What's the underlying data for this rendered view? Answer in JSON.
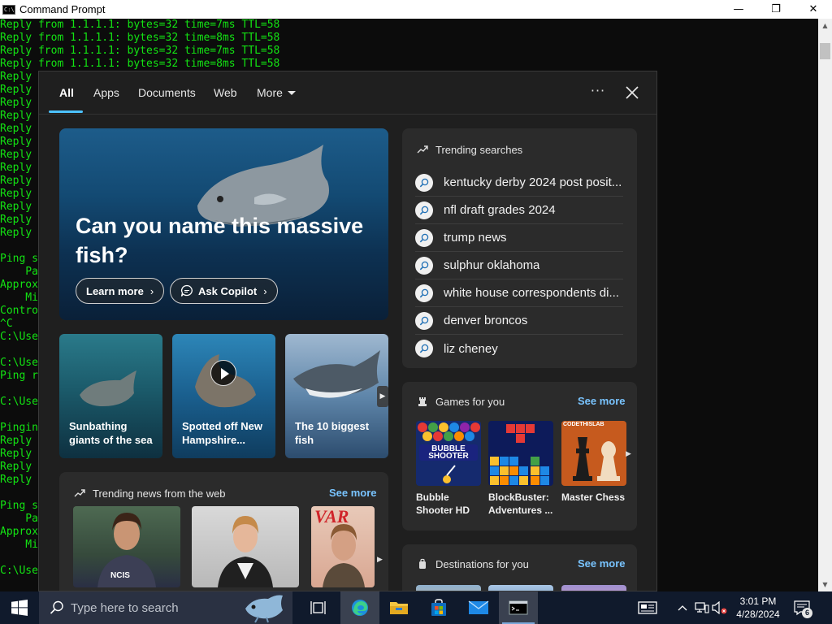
{
  "window": {
    "title": "Command Prompt",
    "minimize_glyph": "—",
    "maximize_glyph": "❐",
    "close_glyph": "✕"
  },
  "console": {
    "ping_reply_lines": [
      "Reply from 1.1.1.1: bytes=32 time=7ms TTL=58",
      "Reply from 1.1.1.1: bytes=32 time=8ms TTL=58",
      "Reply from 1.1.1.1: bytes=32 time=7ms TTL=58",
      "Reply from 1.1.1.1: bytes=32 time=8ms TTL=58"
    ],
    "left_edge_lines": [
      {
        "text": "Reply",
        "kind": "green"
      },
      {
        "text": "Reply",
        "kind": "green"
      },
      {
        "text": "Reply",
        "kind": "green"
      },
      {
        "text": "Reply",
        "kind": "green"
      },
      {
        "text": "Reply",
        "kind": "green"
      },
      {
        "text": "Reply",
        "kind": "green"
      },
      {
        "text": "Reply",
        "kind": "green"
      },
      {
        "text": "Reply",
        "kind": "green"
      },
      {
        "text": "Reply",
        "kind": "green"
      },
      {
        "text": "Reply",
        "kind": "green"
      },
      {
        "text": "Reply",
        "kind": "green"
      },
      {
        "text": "Reply",
        "kind": "green"
      },
      {
        "text": "Reply",
        "kind": "green"
      },
      {
        "text": "",
        "kind": "green"
      },
      {
        "text": "Ping s",
        "kind": "green"
      },
      {
        "text": "    Pa",
        "kind": "green"
      },
      {
        "text": "Approx",
        "kind": "green"
      },
      {
        "text": "    Mi",
        "kind": "green"
      },
      {
        "text": "Contro",
        "kind": "green"
      },
      {
        "text": "^C",
        "kind": "green"
      },
      {
        "text": "C:\\Use",
        "kind": "green"
      },
      {
        "text": "",
        "kind": "green"
      },
      {
        "text": "C:\\Use",
        "kind": "green"
      },
      {
        "text": "Ping r",
        "kind": "green"
      },
      {
        "text": "",
        "kind": "green"
      },
      {
        "text": "C:\\Use",
        "kind": "green"
      },
      {
        "text": "",
        "kind": "green"
      },
      {
        "text": "Pingin",
        "kind": "green"
      },
      {
        "text": "Reply",
        "kind": "green"
      },
      {
        "text": "Reply",
        "kind": "green"
      },
      {
        "text": "Reply",
        "kind": "green"
      },
      {
        "text": "Reply",
        "kind": "green"
      },
      {
        "text": "",
        "kind": "green"
      },
      {
        "text": "Ping s",
        "kind": "green"
      },
      {
        "text": "    Pa",
        "kind": "green"
      },
      {
        "text": "Approx",
        "kind": "green"
      },
      {
        "text": "    Mi",
        "kind": "green"
      },
      {
        "text": "",
        "kind": "green"
      },
      {
        "text": "C:\\Use",
        "kind": "green"
      }
    ]
  },
  "search": {
    "tabs": [
      {
        "label": "All",
        "active": true
      },
      {
        "label": "Apps",
        "active": false
      },
      {
        "label": "Documents",
        "active": false
      },
      {
        "label": "Web",
        "active": false
      },
      {
        "label": "More",
        "active": false
      }
    ],
    "options_glyph": "···",
    "hero": {
      "title": "Can you name this massive fish?",
      "learn_more": "Learn more",
      "ask_copilot": "Ask Copilot",
      "chevron": "›"
    },
    "mini_cards": [
      {
        "caption": "Sunbathing giants of the sea",
        "has_video": false
      },
      {
        "caption": "Spotted off New Hampshire...",
        "has_video": true
      },
      {
        "caption": "The 10 biggest fish",
        "has_video": false
      }
    ],
    "trending_searches": {
      "heading": "Trending searches",
      "items": [
        "kentucky derby 2024 post posit...",
        "nfl draft grades 2024",
        "trump news",
        "sulphur oklahoma",
        "white house correspondents di...",
        "denver broncos",
        "liz cheney"
      ]
    },
    "games": {
      "heading": "Games for you",
      "see_more": "See more",
      "items": [
        {
          "name": "Bubble Shooter HD",
          "tile_text": "BUBBLE SHOOTER"
        },
        {
          "name": "BlockBuster: Adventures ...",
          "tile_text": ""
        },
        {
          "name": "Master Chess",
          "tile_text": "CODETHISLAB"
        }
      ]
    },
    "news": {
      "heading": "Trending news from the web",
      "see_more": "See more",
      "badge": "NCIS",
      "magazine_text": "VAR"
    },
    "destinations": {
      "heading": "Destinations for you",
      "see_more": "See more"
    }
  },
  "taskbar": {
    "search_placeholder": "Type here to search",
    "clock_time": "3:01 PM",
    "clock_date": "4/28/2024",
    "notification_count": "6"
  },
  "colors": {
    "console_green": "#13e313",
    "accent_blue": "#4cc2ff",
    "link_blue": "#79c4ff",
    "flyout_bg": "#1f1f1f",
    "card_bg": "#2b2b2b",
    "taskbar_bg": "#101a2c"
  }
}
